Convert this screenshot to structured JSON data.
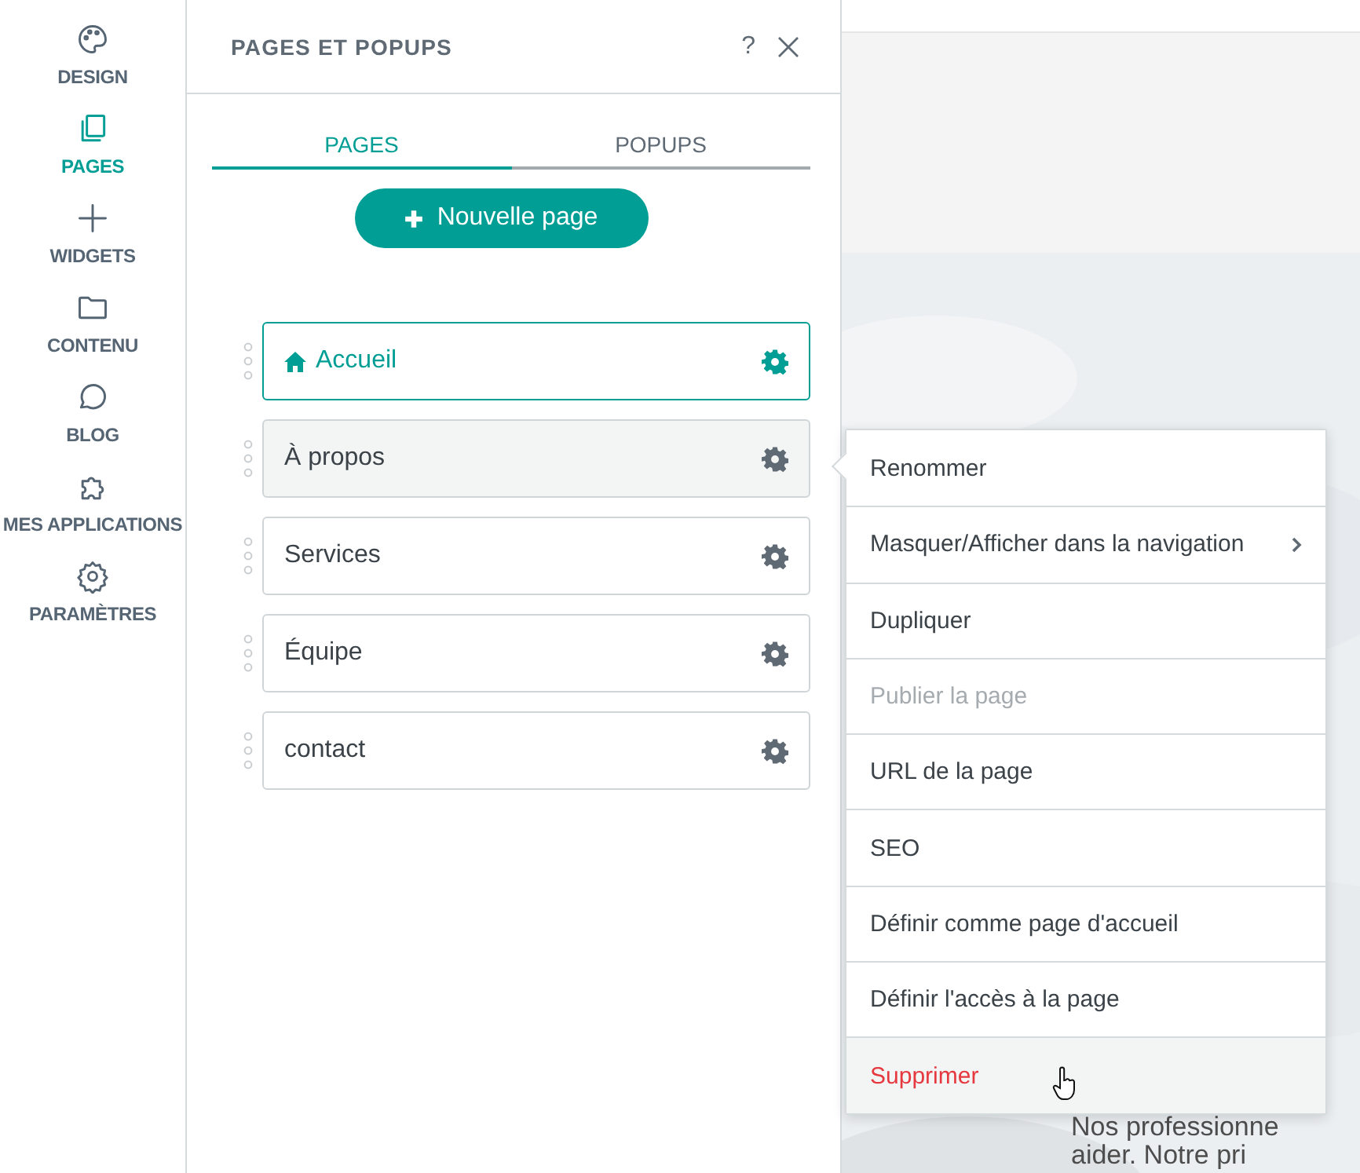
{
  "rail": {
    "items": [
      {
        "label": "DESIGN",
        "selected": false
      },
      {
        "label": "PAGES",
        "selected": true
      },
      {
        "label": "WIDGETS",
        "selected": false
      },
      {
        "label": "CONTENU",
        "selected": false
      },
      {
        "label": "BLOG",
        "selected": false
      },
      {
        "label": "MES APPLICATIONS",
        "selected": false
      },
      {
        "label": "PARAMÈTRES",
        "selected": false
      }
    ]
  },
  "panel": {
    "title": "PAGES ET POPUPS",
    "help": "?",
    "tabs": [
      {
        "label": "PAGES",
        "selected": true
      },
      {
        "label": "POPUPS",
        "selected": false
      }
    ],
    "new_button": "Nouvelle page",
    "pages": [
      {
        "name": "Accueil",
        "home": true,
        "selected": true,
        "menu_open": false
      },
      {
        "name": "À propos",
        "home": false,
        "selected": false,
        "menu_open": true
      },
      {
        "name": "Services",
        "home": false,
        "selected": false,
        "menu_open": false
      },
      {
        "name": "Équipe",
        "home": false,
        "selected": false,
        "menu_open": false
      },
      {
        "name": "contact",
        "home": false,
        "selected": false,
        "menu_open": false
      }
    ]
  },
  "context_menu": {
    "items": [
      {
        "label": "Renommer",
        "kind": "plain",
        "disabled": false,
        "hovered": false
      },
      {
        "label": "Masquer/Afficher dans la navigation",
        "kind": "submenu",
        "disabled": false,
        "hovered": false
      },
      {
        "label": "Dupliquer",
        "kind": "plain",
        "disabled": false,
        "hovered": false
      },
      {
        "label": "Publier la page",
        "kind": "plain",
        "disabled": true,
        "hovered": false
      },
      {
        "label": "URL de la page",
        "kind": "plain",
        "disabled": false,
        "hovered": false
      },
      {
        "label": "SEO",
        "kind": "plain",
        "disabled": false,
        "hovered": false
      },
      {
        "label": "Définir comme page d'accueil",
        "kind": "plain",
        "disabled": false,
        "hovered": false
      },
      {
        "label": "Définir l'accès à la page",
        "kind": "plain",
        "disabled": false,
        "hovered": false
      },
      {
        "label": "Supprimer",
        "kind": "danger",
        "disabled": false,
        "hovered": true
      }
    ]
  },
  "preview": {
    "lines": [
      "Nos professionne",
      "aider. Notre pri"
    ]
  }
}
